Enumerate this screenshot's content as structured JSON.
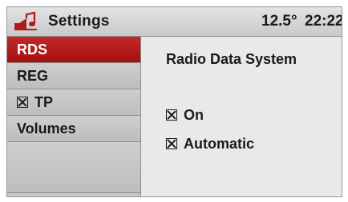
{
  "header": {
    "logo_icon": "music-note-speaker-icon",
    "title": "Settings",
    "temperature": "12.5°",
    "time": "22:22"
  },
  "sidebar": {
    "items": [
      {
        "label": "RDS",
        "selected": true
      },
      {
        "label": "REG",
        "selected": false
      },
      {
        "label": "TP",
        "checked": true
      },
      {
        "label": "Volumes",
        "selected": false
      }
    ]
  },
  "main": {
    "title": "Radio Data System",
    "options": [
      {
        "label": "On",
        "checked": true
      },
      {
        "label": "Automatic",
        "checked": true
      }
    ]
  },
  "colors": {
    "accent": "#b01a1a",
    "panel": "#e9e9e9",
    "menu": "#c9c9c9"
  }
}
